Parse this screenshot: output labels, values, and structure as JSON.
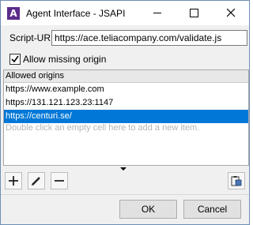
{
  "window": {
    "title": "Agent Interface - JSAPI",
    "app_icon_glyph": "A",
    "accent_color": "#5b2c8a"
  },
  "script_url": {
    "label": "Script-URL",
    "value": "https://ace.teliacompany.com/validate.js"
  },
  "allow_missing_origin": {
    "label": "Allow missing origin",
    "checked": true
  },
  "origins": {
    "header": "Allowed origins",
    "items": [
      {
        "value": "https://www.example.com",
        "selected": false
      },
      {
        "value": "https://131.121.123.23:1147",
        "selected": false
      },
      {
        "value": "https://centuri.se/",
        "selected": true
      }
    ],
    "hint": "Double click an empty cell here to add a new item.",
    "selection_color": "#0078d7"
  },
  "toolbar": {
    "add_icon": "plus-icon",
    "edit_icon": "pencil-icon",
    "remove_icon": "minus-icon",
    "paste_icon": "clipboard-paste-icon"
  },
  "buttons": {
    "ok": "OK",
    "cancel": "Cancel"
  }
}
